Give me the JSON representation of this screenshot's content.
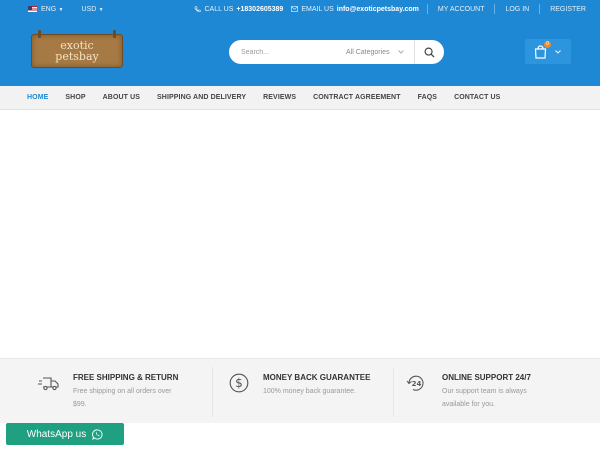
{
  "topbar": {
    "language": "ENG",
    "currency": "USD",
    "phone_label": "CALL US",
    "phone_value": "+18302605389",
    "email_label": "EMAIL US",
    "email_value": "info@exoticpetsbay.com",
    "my_account": "MY ACCOUNT",
    "login": "LOG IN",
    "register": "REGISTER"
  },
  "header": {
    "logo_line1": "exotic",
    "logo_line2": "petsbay",
    "search_placeholder": "Search...",
    "category_select": "All Categories",
    "cart_count": "0"
  },
  "nav": {
    "items": [
      "HOME",
      "SHOP",
      "ABOUT US",
      "SHIPPING AND DELIVERY",
      "REVIEWS",
      "CONTRACT AGREEMENT",
      "FAQS",
      "CONTACT US"
    ],
    "active": "HOME"
  },
  "features": [
    {
      "title": "FREE SHIPPING & RETURN",
      "line1": "Free shipping on all orders over",
      "line2": "$99.",
      "icon": "truck-icon"
    },
    {
      "title": "MONEY BACK GUARANTEE",
      "line1": "100% money back guarantee.",
      "line2": "",
      "icon": "dollar-circle-icon"
    },
    {
      "title": "ONLINE SUPPORT 24/7",
      "line1": "Our support team is always",
      "line2": "available for you.",
      "icon": "support-24-icon"
    }
  ],
  "whatsapp": {
    "label": "WhatsApp us"
  },
  "colors": {
    "primary": "#1e88d4",
    "whatsapp": "#1fa080",
    "badge": "#f08a24"
  }
}
